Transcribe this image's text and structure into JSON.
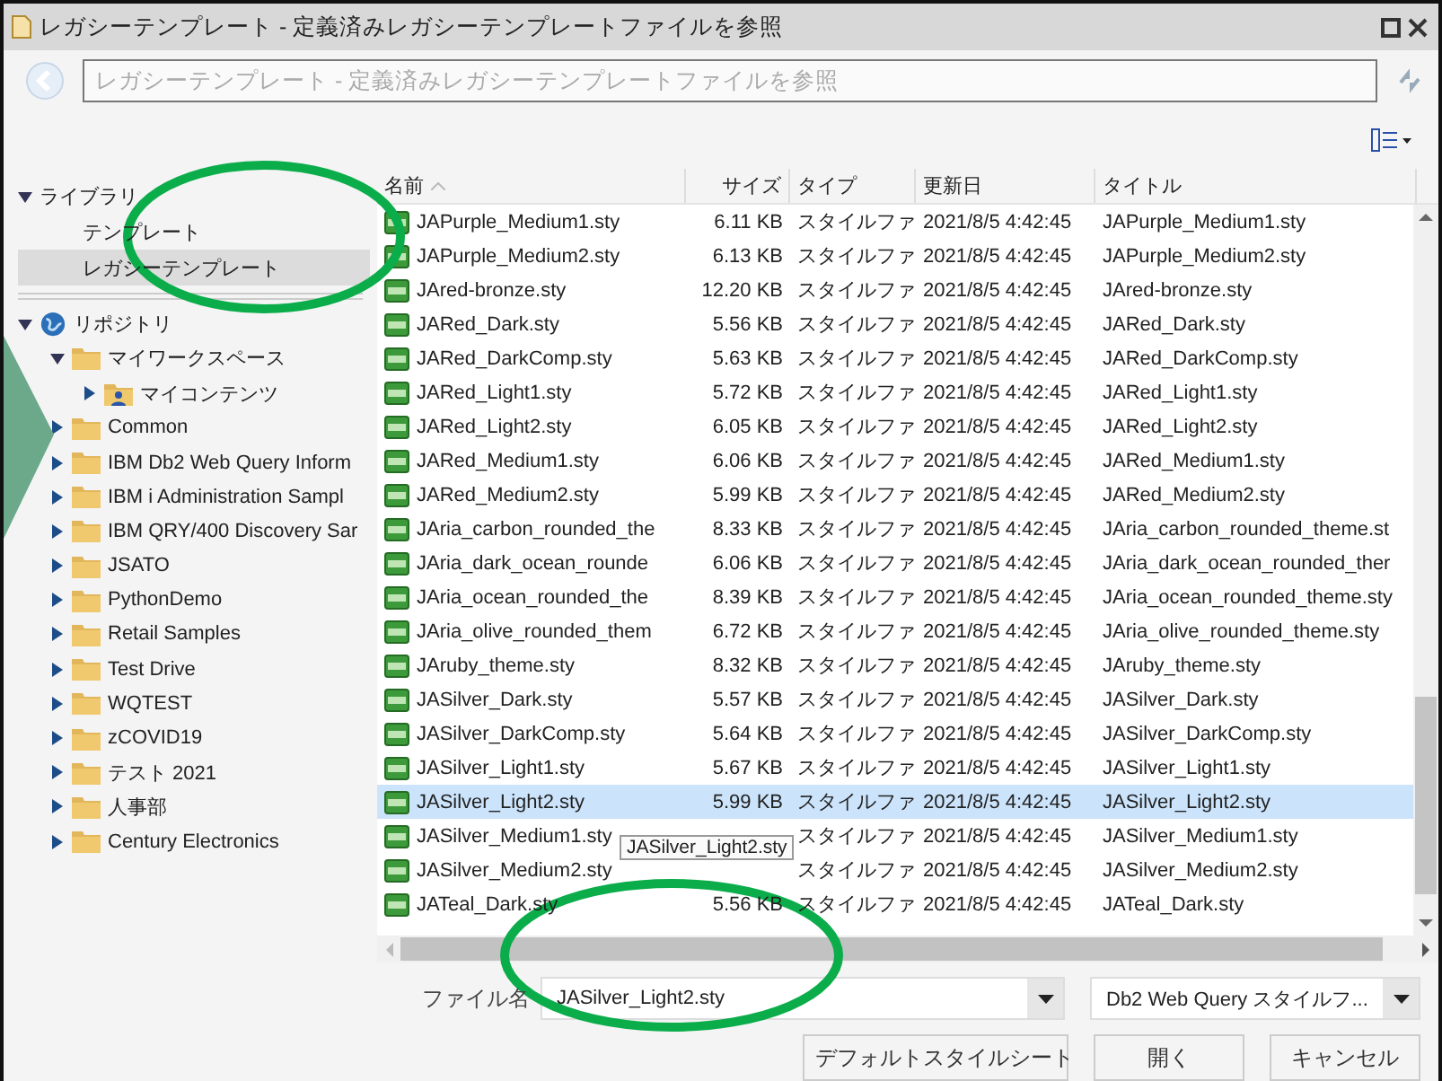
{
  "window": {
    "title": "レガシーテンプレート - 定義済みレガシーテンプレートファイルを参照"
  },
  "address": {
    "placeholder": "レガシーテンプレート - 定義済みレガシーテンプレートファイルを参照"
  },
  "library": {
    "label": "ライブラリ",
    "expanded": true,
    "items": [
      {
        "label": "テンプレート",
        "selected": false
      },
      {
        "label": "レガシーテンプレート",
        "selected": true
      }
    ]
  },
  "repository": {
    "label": "リポジトリ",
    "kind": "repository",
    "expanded": true,
    "children": [
      {
        "label": "マイワークスペース",
        "kind": "folder",
        "expanded": true,
        "children": [
          {
            "label": "マイコンテンツ",
            "kind": "user-folder",
            "expanded": false
          }
        ]
      },
      {
        "label": "Common",
        "kind": "folder",
        "expanded": false
      },
      {
        "label": "IBM Db2 Web Query Inform",
        "kind": "folder",
        "expanded": false
      },
      {
        "label": "IBM i Administration Sampl",
        "kind": "folder",
        "expanded": false
      },
      {
        "label": "IBM QRY/400 Discovery Sar",
        "kind": "folder",
        "expanded": false
      },
      {
        "label": "JSATO",
        "kind": "folder",
        "expanded": false
      },
      {
        "label": "PythonDemo",
        "kind": "folder",
        "expanded": false
      },
      {
        "label": "Retail Samples",
        "kind": "folder",
        "expanded": false
      },
      {
        "label": "Test Drive",
        "kind": "folder",
        "expanded": false
      },
      {
        "label": "WQTEST",
        "kind": "folder",
        "expanded": false
      },
      {
        "label": "zCOVID19",
        "kind": "folder",
        "expanded": false
      },
      {
        "label": "テスト 2021",
        "kind": "folder",
        "expanded": false
      },
      {
        "label": "人事部",
        "kind": "folder",
        "expanded": false
      },
      {
        "label": "Century Electronics",
        "kind": "folder",
        "expanded": false
      }
    ]
  },
  "table": {
    "columns": [
      "名前",
      "サイズ",
      "タイプ",
      "更新日",
      "タイトル"
    ],
    "rows": [
      {
        "name": "JAPurple_Medium1.sty",
        "size": "6.11 KB",
        "type": "スタイルファ",
        "modified": "2021/8/5 4:42:45",
        "title": "JAPurple_Medium1.sty",
        "selected": false
      },
      {
        "name": "JAPurple_Medium2.sty",
        "size": "6.13 KB",
        "type": "スタイルファ",
        "modified": "2021/8/5 4:42:45",
        "title": "JAPurple_Medium2.sty",
        "selected": false
      },
      {
        "name": "JAred-bronze.sty",
        "size": "12.20 KB",
        "type": "スタイルファ",
        "modified": "2021/8/5 4:42:45",
        "title": "JAred-bronze.sty",
        "selected": false
      },
      {
        "name": "JARed_Dark.sty",
        "size": "5.56 KB",
        "type": "スタイルファ",
        "modified": "2021/8/5 4:42:45",
        "title": "JARed_Dark.sty",
        "selected": false
      },
      {
        "name": "JARed_DarkComp.sty",
        "size": "5.63 KB",
        "type": "スタイルファ",
        "modified": "2021/8/5 4:42:45",
        "title": "JARed_DarkComp.sty",
        "selected": false
      },
      {
        "name": "JARed_Light1.sty",
        "size": "5.72 KB",
        "type": "スタイルファ",
        "modified": "2021/8/5 4:42:45",
        "title": "JARed_Light1.sty",
        "selected": false
      },
      {
        "name": "JARed_Light2.sty",
        "size": "6.05 KB",
        "type": "スタイルファ",
        "modified": "2021/8/5 4:42:45",
        "title": "JARed_Light2.sty",
        "selected": false
      },
      {
        "name": "JARed_Medium1.sty",
        "size": "6.06 KB",
        "type": "スタイルファ",
        "modified": "2021/8/5 4:42:45",
        "title": "JARed_Medium1.sty",
        "selected": false
      },
      {
        "name": "JARed_Medium2.sty",
        "size": "5.99 KB",
        "type": "スタイルファ",
        "modified": "2021/8/5 4:42:45",
        "title": "JARed_Medium2.sty",
        "selected": false
      },
      {
        "name": "JAria_carbon_rounded_the",
        "size": "8.33 KB",
        "type": "スタイルファ",
        "modified": "2021/8/5 4:42:45",
        "title": "JAria_carbon_rounded_theme.st",
        "selected": false
      },
      {
        "name": "JAria_dark_ocean_rounde",
        "size": "6.06 KB",
        "type": "スタイルファ",
        "modified": "2021/8/5 4:42:45",
        "title": "JAria_dark_ocean_rounded_ther",
        "selected": false
      },
      {
        "name": "JAria_ocean_rounded_the",
        "size": "8.39 KB",
        "type": "スタイルファ",
        "modified": "2021/8/5 4:42:45",
        "title": "JAria_ocean_rounded_theme.sty",
        "selected": false
      },
      {
        "name": "JAria_olive_rounded_them",
        "size": "6.72 KB",
        "type": "スタイルファ",
        "modified": "2021/8/5 4:42:45",
        "title": "JAria_olive_rounded_theme.sty",
        "selected": false
      },
      {
        "name": "JAruby_theme.sty",
        "size": "8.32 KB",
        "type": "スタイルファ",
        "modified": "2021/8/5 4:42:45",
        "title": "JAruby_theme.sty",
        "selected": false
      },
      {
        "name": "JASilver_Dark.sty",
        "size": "5.57 KB",
        "type": "スタイルファ",
        "modified": "2021/8/5 4:42:45",
        "title": "JASilver_Dark.sty",
        "selected": false
      },
      {
        "name": "JASilver_DarkComp.sty",
        "size": "5.64 KB",
        "type": "スタイルファ",
        "modified": "2021/8/5 4:42:45",
        "title": "JASilver_DarkComp.sty",
        "selected": false
      },
      {
        "name": "JASilver_Light1.sty",
        "size": "5.67 KB",
        "type": "スタイルファ",
        "modified": "2021/8/5 4:42:45",
        "title": "JASilver_Light1.sty",
        "selected": false
      },
      {
        "name": "JASilver_Light2.sty",
        "size": "5.99 KB",
        "type": "スタイルファ",
        "modified": "2021/8/5 4:42:45",
        "title": "JASilver_Light2.sty",
        "selected": true
      },
      {
        "name": "JASilver_Medium1.sty",
        "type": "スタイルファ",
        "modified": "2021/8/5 4:42:45",
        "title": "JASilver_Medium1.sty",
        "selected": false
      },
      {
        "name": "JASilver_Medium2.sty",
        "type": "スタイルファ",
        "modified": "2021/8/5 4:42:45",
        "title": "JASilver_Medium2.sty",
        "selected": false
      },
      {
        "name": "JATeal_Dark.sty",
        "size": "5.56 KB",
        "type": "スタイルファ",
        "modified": "2021/8/5 4:42:45",
        "title": "JATeal_Dark.sty",
        "selected": false
      }
    ]
  },
  "tooltip": "JASilver_Light2.sty",
  "filename": {
    "label": "ファイル名",
    "value": "JASilver_Light2.sty"
  },
  "filetype": {
    "value": "Db2 Web Query スタイルフ..."
  },
  "buttons": [
    "デフォルトスタイルシート",
    "開く",
    "キャンセル"
  ]
}
